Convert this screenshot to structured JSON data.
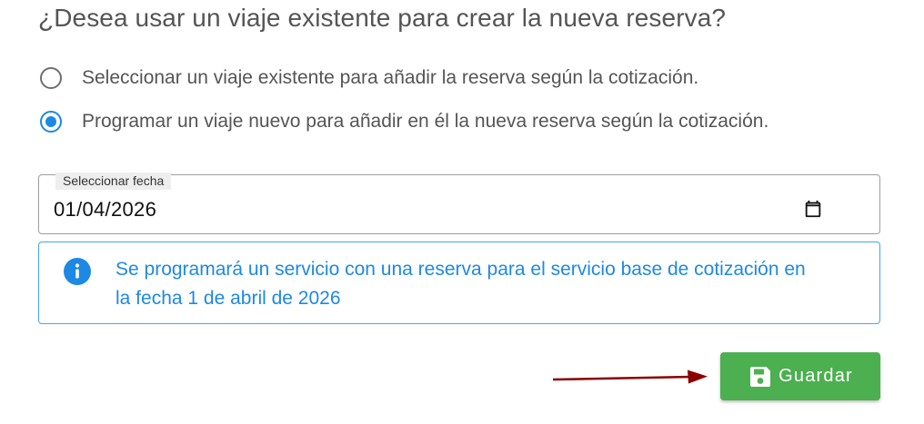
{
  "question": "¿Desea usar un viaje existente para crear la nueva reserva?",
  "options": [
    {
      "label": "Seleccionar un viaje existente para añadir la reserva según la cotización.",
      "selected": false
    },
    {
      "label": "Programar un viaje nuevo para añadir en él la nueva reserva según la cotización.",
      "selected": true
    }
  ],
  "date_field": {
    "label": "Seleccionar fecha",
    "value": "01/04/2026",
    "icon": "calendar-icon"
  },
  "info": {
    "icon": "info-icon",
    "text": "Se programará un servicio con una reserva para el servicio base de cotización en la fecha 1 de abril de 2026",
    "color": "#1e88e5"
  },
  "save_button": {
    "label": "Guardar",
    "icon": "save-icon",
    "color": "#4caf50"
  },
  "annotation": {
    "type": "arrow",
    "color": "#8b0000"
  }
}
